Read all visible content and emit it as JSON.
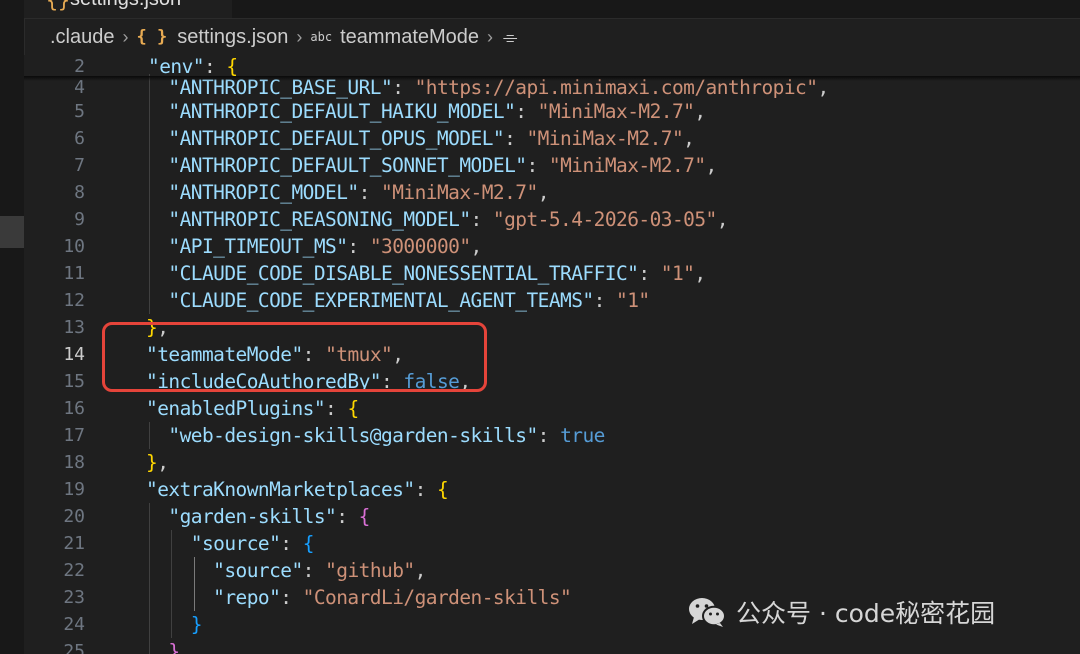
{
  "tab": {
    "label": "settings.json",
    "icon": "json-braces-icon"
  },
  "breadcrumb": {
    "items": [
      ".claude",
      "settings.json",
      "teammateMode"
    ],
    "file_icon": "{ }",
    "property_icon_text": "abc"
  },
  "editor": {
    "active_line": "14",
    "lines": [
      {
        "n": "2",
        "text": "\"env\": {"
      },
      {
        "n": "4",
        "text": "\"ANTHROPIC_BASE_URL\": \"https://api.minimaxi.com/anthropic\","
      },
      {
        "n": "5",
        "text": "\"ANTHROPIC_DEFAULT_HAIKU_MODEL\": \"MiniMax-M2.7\","
      },
      {
        "n": "6",
        "text": "\"ANTHROPIC_DEFAULT_OPUS_MODEL\": \"MiniMax-M2.7\","
      },
      {
        "n": "7",
        "text": "\"ANTHROPIC_DEFAULT_SONNET_MODEL\": \"MiniMax-M2.7\","
      },
      {
        "n": "8",
        "text": "\"ANTHROPIC_MODEL\": \"MiniMax-M2.7\","
      },
      {
        "n": "9",
        "text": "\"ANTHROPIC_REASONING_MODEL\": \"gpt-5.4-2026-03-05\","
      },
      {
        "n": "10",
        "text": "\"API_TIMEOUT_MS\": \"3000000\","
      },
      {
        "n": "11",
        "text": "\"CLAUDE_CODE_DISABLE_NONESSENTIAL_TRAFFIC\": \"1\","
      },
      {
        "n": "12",
        "text": "\"CLAUDE_CODE_EXPERIMENTAL_AGENT_TEAMS\": \"1\""
      },
      {
        "n": "13",
        "text": "},"
      },
      {
        "n": "14",
        "text": "\"teammateMode\": \"tmux\","
      },
      {
        "n": "15",
        "text": "\"includeCoAuthoredBy\": false,"
      },
      {
        "n": "16",
        "text": "\"enabledPlugins\": {"
      },
      {
        "n": "17",
        "text": "\"web-design-skills@garden-skills\": true"
      },
      {
        "n": "18",
        "text": "},"
      },
      {
        "n": "19",
        "text": "\"extraKnownMarketplaces\": {"
      },
      {
        "n": "20",
        "text": "\"garden-skills\": {"
      },
      {
        "n": "21",
        "text": "\"source\": {"
      },
      {
        "n": "22",
        "text": "\"source\": \"github\","
      },
      {
        "n": "23",
        "text": "\"repo\": \"ConardLi/garden-skills\""
      },
      {
        "n": "24",
        "text": "}"
      },
      {
        "n": "25",
        "text": "}"
      }
    ]
  },
  "watermark": {
    "text": "公众号 · code秘密花园",
    "icon": "wechat-icon"
  },
  "colors": {
    "editor_bg": "#1f1f1f",
    "key": "#9cdcfe",
    "string": "#ce9178",
    "boolean": "#569cd6",
    "bracket_1": "#ffd700",
    "bracket_2": "#da70d6",
    "bracket_3": "#179fff",
    "highlight_box": "#e5443a"
  }
}
